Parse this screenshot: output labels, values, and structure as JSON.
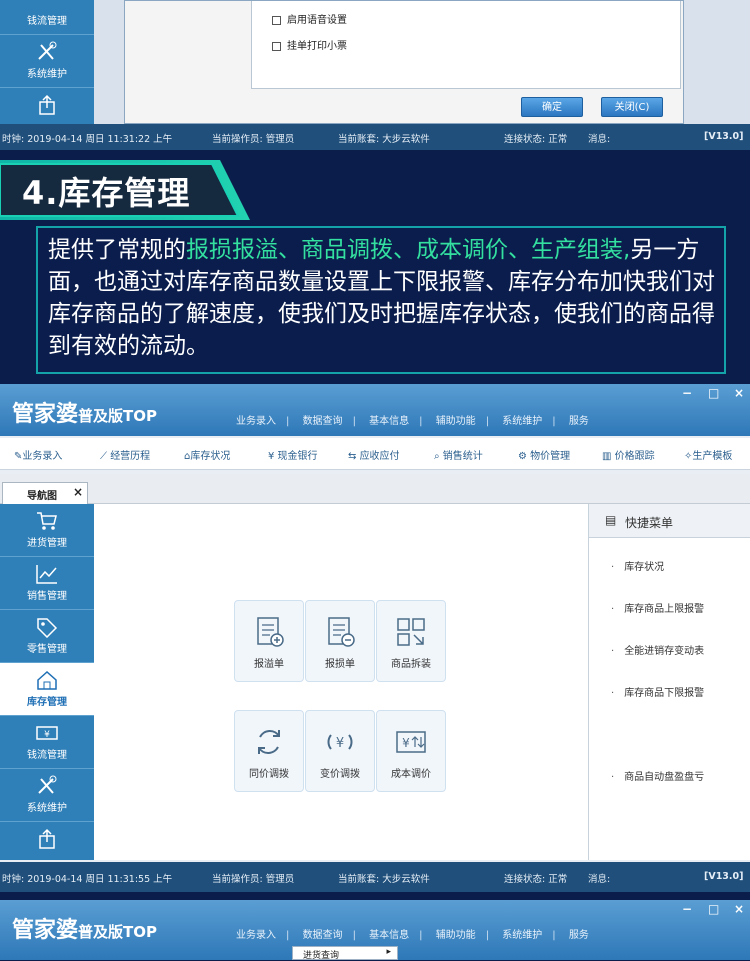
{
  "top_window": {
    "sidebar": [
      {
        "label": "钱流管理",
        "icon": "money-icon"
      },
      {
        "label": "系统维护",
        "icon": "tools-icon"
      },
      {
        "label": "",
        "icon": "export-icon"
      }
    ],
    "options": [
      "启用语音设置",
      "挂单打印小票"
    ],
    "ok_label": "确定",
    "close_label": "关闭(C)",
    "status": {
      "time": "时钟: 2019-04-14 周日 11:31:22 上午",
      "operator": "当前操作员: 管理员",
      "account": "当前账套: 大步云软件",
      "connection": "连接状态: 正常",
      "message": "消息:",
      "version": "[V13.0]"
    }
  },
  "section": {
    "title": "4.库存管理",
    "desc_prefix": "提供了常规的",
    "desc_highlight": "报损报溢、商品调拨、成本调价、生产组装,",
    "desc_rest": "另一方面，也通过对库存商品数量设置上下限报警、库存分布加快我们对库存商品的了解速度，使我们及时把握库存状态，使我们的商品得到有效的流动。"
  },
  "main_window": {
    "logo_main": "管家婆",
    "logo_sub": "普及版TOP",
    "menu": [
      "业务录入",
      "数据查询",
      "基本信息",
      "辅助功能",
      "系统维护",
      "服务"
    ],
    "window_controls": [
      "−",
      "□",
      "×"
    ],
    "toolbar": [
      {
        "label": "业务录入",
        "icon": "pen-icon"
      },
      {
        "label": "经营历程",
        "icon": "chart-icon"
      },
      {
        "label": "库存状况",
        "icon": "home-icon"
      },
      {
        "label": "现金银行",
        "icon": "yen-icon"
      },
      {
        "label": "应收应付",
        "icon": "swap-icon"
      },
      {
        "label": "销售统计",
        "icon": "search-icon"
      },
      {
        "label": "物价管理",
        "icon": "gear-icon"
      },
      {
        "label": "价格跟踪",
        "icon": "bar-icon"
      },
      {
        "label": "生产模板",
        "icon": "wrench-icon"
      }
    ],
    "tab_label": "导航图",
    "sidebar": [
      {
        "label": "进货管理",
        "icon": "cart-icon"
      },
      {
        "label": "销售管理",
        "icon": "trend-icon"
      },
      {
        "label": "零售管理",
        "icon": "tag-icon"
      },
      {
        "label": "库存管理",
        "icon": "house-icon"
      },
      {
        "label": "钱流管理",
        "icon": "money-icon"
      },
      {
        "label": "系统维护",
        "icon": "tools-icon"
      },
      {
        "label": "",
        "icon": "export-icon"
      }
    ],
    "quick_buttons": [
      {
        "label": "报溢单",
        "icon": "notebook-plus-icon"
      },
      {
        "label": "报损单",
        "icon": "notebook-minus-icon"
      },
      {
        "label": "商品拆装",
        "icon": "grid-icon"
      },
      {
        "label": "同价调拨",
        "icon": "cycle-icon"
      },
      {
        "label": "变价调拨",
        "icon": "yen-cycle-icon"
      },
      {
        "label": "成本调价",
        "icon": "price-adjust-icon"
      }
    ],
    "shortcut_title": "快捷菜单",
    "shortcuts": [
      "库存状况",
      "库存商品上限报警",
      "全能进销存变动表",
      "库存商品下限报警",
      "商品自动盘盈盘亏"
    ],
    "status": {
      "time": "时钟: 2019-04-14 周日 11:31:55 上午",
      "operator": "当前操作员: 管理员",
      "account": "当前账套: 大步云软件",
      "connection": "连接状态: 正常",
      "message": "消息:",
      "version": "[V13.0]"
    }
  },
  "bottom_window": {
    "logo_main": "管家婆",
    "logo_sub": "普及版TOP",
    "menu": [
      "业务录入",
      "数据查询",
      "基本信息",
      "辅助功能",
      "系统维护",
      "服务"
    ],
    "window_controls": [
      "−",
      "□",
      "×"
    ],
    "dropdown_item": "进货查询"
  },
  "colors": {
    "accent": "#2e78b8",
    "highlight": "#33e0a0",
    "banner": "#12c4b0",
    "bg": "#0b1d4a"
  }
}
